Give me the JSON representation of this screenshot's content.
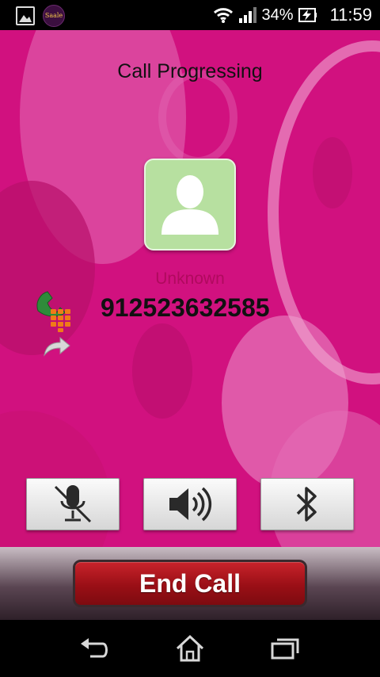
{
  "status_bar": {
    "app_icon_text": "Saale",
    "battery_percent": "34%",
    "time": "11:59"
  },
  "call": {
    "status": "Call Progressing",
    "contact_name": "Unknown",
    "number": "912523632585"
  },
  "controls": {
    "mute_icon": "mic-muted-icon",
    "speaker_icon": "speaker-icon",
    "bluetooth_icon": "bluetooth-icon"
  },
  "end_call": {
    "label": "End Call",
    "color": "#a3131b"
  },
  "nav": {
    "back_icon": "back-icon",
    "home_icon": "home-icon",
    "recent_icon": "recent-apps-icon"
  },
  "colors": {
    "background": "#d1117f",
    "avatar": "#b7e0a0"
  }
}
